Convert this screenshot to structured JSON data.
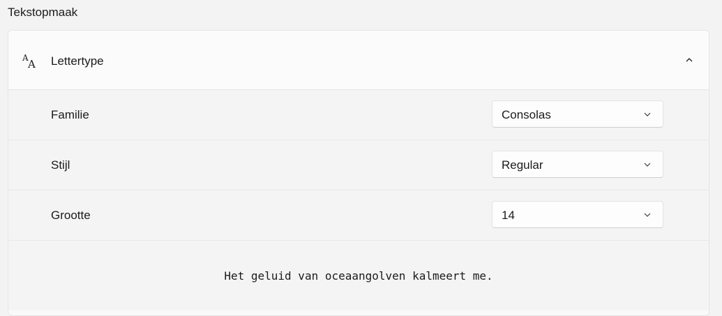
{
  "section_title": "Tekstopmaak",
  "font_group": {
    "header_label": "Lettertype",
    "expanded": true,
    "rows": [
      {
        "label": "Familie",
        "value": "Consolas"
      },
      {
        "label": "Stijl",
        "value": "Regular"
      },
      {
        "label": "Grootte",
        "value": "14"
      }
    ],
    "preview_text": "Het geluid van oceaangolven kalmeert me."
  },
  "icons": {
    "header": "font-icon",
    "collapse": "chevron-up-icon",
    "dropdown": "chevron-down-icon"
  }
}
